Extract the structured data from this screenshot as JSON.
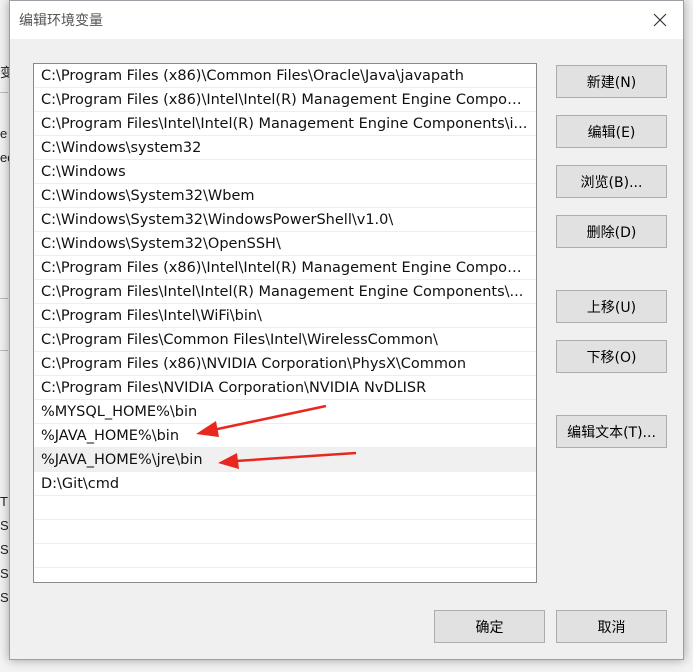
{
  "dialog": {
    "title": "编辑环境变量"
  },
  "path_entries": [
    "C:\\Program Files (x86)\\Common Files\\Oracle\\Java\\javapath",
    "C:\\Program Files (x86)\\Intel\\Intel(R) Management Engine Compon...",
    "C:\\Program Files\\Intel\\Intel(R) Management Engine Components\\i...",
    "C:\\Windows\\system32",
    "C:\\Windows",
    "C:\\Windows\\System32\\Wbem",
    "C:\\Windows\\System32\\WindowsPowerShell\\v1.0\\",
    "C:\\Windows\\System32\\OpenSSH\\",
    "C:\\Program Files (x86)\\Intel\\Intel(R) Management Engine Compon...",
    "C:\\Program Files\\Intel\\Intel(R) Management Engine Components\\...",
    "C:\\Program Files\\Intel\\WiFi\\bin\\",
    "C:\\Program Files\\Common Files\\Intel\\WirelessCommon\\",
    "C:\\Program Files (x86)\\NVIDIA Corporation\\PhysX\\Common",
    "C:\\Program Files\\NVIDIA Corporation\\NVIDIA NvDLISR",
    "%MYSQL_HOME%\\bin",
    "%JAVA_HOME%\\bin",
    "%JAVA_HOME%\\jre\\bin",
    "D:\\Git\\cmd"
  ],
  "selected_index": 16,
  "buttons": {
    "new": "新建(N)",
    "edit": "编辑(E)",
    "browse": "浏览(B)...",
    "delete": "删除(D)",
    "move_up": "上移(U)",
    "move_down": "下移(O)",
    "edit_text": "编辑文本(T)...",
    "ok": "确定",
    "cancel": "取消"
  },
  "background_fragments": [
    "变",
    "e",
    "ed",
    "T",
    "S",
    "S",
    "S",
    "S"
  ],
  "colors": {
    "annotation_arrow": "#e8281e",
    "selected_row": "#f0f0f0",
    "button_bg": "#e1e1e1"
  },
  "icons": {
    "close": "close-icon",
    "arrow": "annotation-arrow"
  }
}
